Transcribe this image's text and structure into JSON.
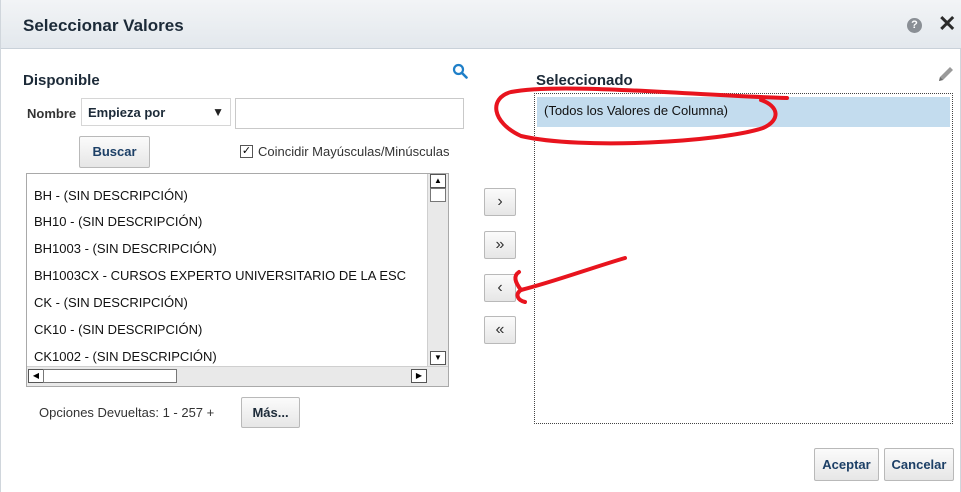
{
  "dialog": {
    "title": "Seleccionar Valores",
    "help_glyph": "?",
    "close_glyph": "✕"
  },
  "available": {
    "heading": "Disponible",
    "name_label": "Nombre",
    "match_mode": "Empieza por",
    "search_value": "",
    "search_button": "Buscar",
    "case_checkbox": {
      "label": "Coincidir Mayúsculas/Minúsculas",
      "checked": true,
      "mark": "✓"
    },
    "items": [
      "BH - (SIN DESCRIPCIÓN)",
      "BH10 - (SIN DESCRIPCIÓN)",
      "BH1003 - (SIN DESCRIPCIÓN)",
      "BH1003CX - CURSOS EXPERTO UNIVERSITARIO DE LA ESC",
      "CK - (SIN DESCRIPCIÓN)",
      "CK10 - (SIN DESCRIPCIÓN)",
      "CK1002 - (SIN DESCRIPCIÓN)"
    ],
    "options_returned": "Opciones Devueltas: 1 - 257 +",
    "more_button": "Más..."
  },
  "move_buttons": {
    "move": "›",
    "move_all": "»",
    "remove": "‹",
    "remove_all": "«"
  },
  "selected": {
    "heading": "Seleccionado",
    "items": [
      "(Todos los Valores de Columna)"
    ]
  },
  "footer": {
    "accept": "Aceptar",
    "cancel": "Cancelar"
  },
  "colors": {
    "accent_text": "#1c3f66",
    "selected_row": "#c3dcee",
    "search_icon": "#1f7fc8",
    "annotation": "#e8141e"
  },
  "icons": [
    "search-icon",
    "pencil-icon",
    "help-icon",
    "close-icon"
  ]
}
